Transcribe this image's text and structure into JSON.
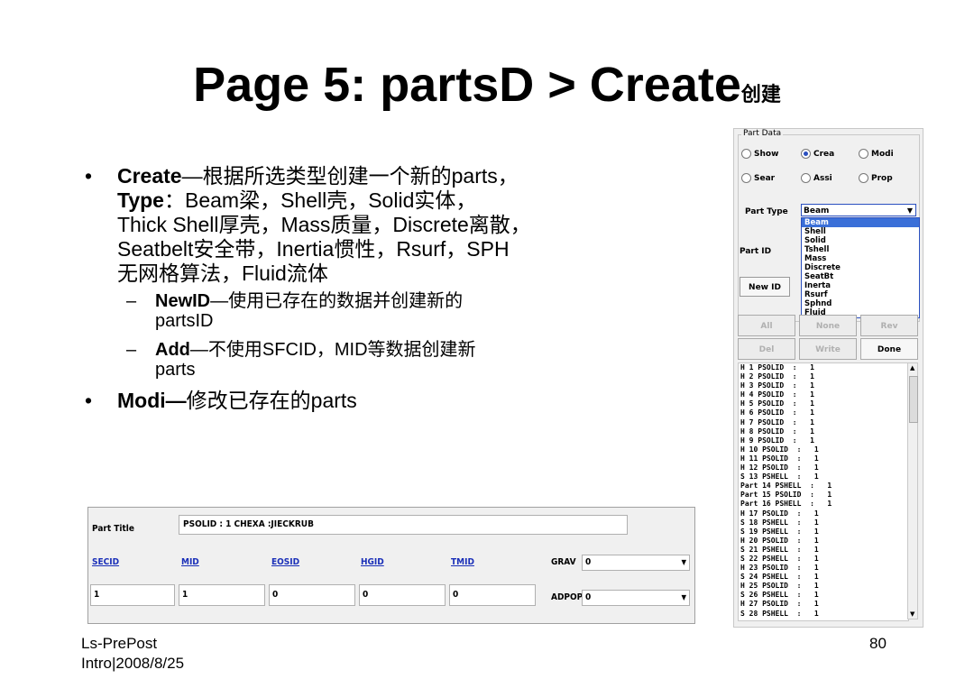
{
  "title": {
    "main": "Page 5: partsD > Create",
    "suffix": "创建"
  },
  "bullets": {
    "b1": {
      "lead": "Create",
      "rest": "—根据所选类型创建一个新的parts，",
      "line2_lead": "Type",
      "line2_rest": "：Beam梁，Shell壳，Solid实体，",
      "line3": "Thick Shell厚壳，Mass质量，Discrete离散，",
      "line4": "Seatbelt安全带，Inertia惯性，Rsurf，SPH",
      "line5": "无网格算法，Fluid流体"
    },
    "s1": {
      "dash": "–",
      "lead": "NewID",
      "rest": "—使用已存在的数据并创建新的",
      "line2": "partsID"
    },
    "s2": {
      "dash": "–",
      "lead": "Add",
      "rest": "—不使用SFCID，MID等数据创建新",
      "line2": "parts"
    },
    "b2": {
      "lead": "Modi—",
      "rest": "修改已存在的parts"
    },
    "dot": "•"
  },
  "footer": {
    "left1": "Ls-PrePost",
    "left2": "Intro|2008/8/25",
    "page": "80"
  },
  "part_data": {
    "legend": "Part Data",
    "radios": [
      {
        "label": "Show",
        "on": false
      },
      {
        "label": "Crea",
        "on": true
      },
      {
        "label": "Modi",
        "on": false
      },
      {
        "label": "Sear",
        "on": false
      },
      {
        "label": "Assi",
        "on": false
      },
      {
        "label": "Prop",
        "on": false
      }
    ],
    "part_type_label": "Part Type",
    "part_type_value": "Beam",
    "type_options": [
      "Beam",
      "Shell",
      "Solid",
      "Tshell",
      "Mass",
      "Discrete",
      "SeatBt",
      "Inerta",
      "Rsurf",
      "Sphnd",
      "Fluid"
    ],
    "part_id_label": "Part ID",
    "new_id_label": "New ID",
    "btn_all": "All",
    "btn_none": "None",
    "btn_rev": "Rev",
    "btn_del": "Del",
    "btn_write": "Write",
    "btn_done": "Done",
    "parts": [
      "H 1 PSOLID  :   1",
      "H 2 PSOLID  :   1",
      "H 3 PSOLID  :   1",
      "H 4 PSOLID  :   1",
      "H 5 PSOLID  :   1",
      "H 6 PSOLID  :   1",
      "H 7 PSOLID  :   1",
      "H 8 PSOLID  :   1",
      "H 9 PSOLID  :   1",
      "H 10 PSOLID  :   1",
      "H 11 PSOLID  :   1",
      "H 12 PSOLID  :   1",
      "S 13 PSHELL  :   1",
      "Part 14 PSHELL  :   1",
      "Part 15 PSOLID  :   1",
      "Part 16 PSHELL  :   1",
      "H 17 PSOLID  :   1",
      "S 18 PSHELL  :   1",
      "S 19 PSHELL  :   1",
      "H 20 PSOLID  :   1",
      "S 21 PSHELL  :   1",
      "S 22 PSHELL  :   1",
      "H 23 PSOLID  :   1",
      "S 24 PSHELL  :   1",
      "H 25 PSOLID  :   1",
      "S 26 PSHELL  :   1",
      "H 27 PSOLID  :   1",
      "S 28 PSHELL  :   1"
    ]
  },
  "part_title": {
    "label": "Part Title",
    "value": "PSOLID  :   1     CHEXA :JIECKRUB",
    "headers": [
      "SECID",
      "MID",
      "EOSID",
      "HGID",
      "TMID"
    ],
    "values": [
      "1",
      "1",
      "0",
      "0",
      "0"
    ],
    "grav_label": "GRAV",
    "grav_value": "0",
    "adpopt_label": "ADPOPT",
    "adpopt_value": "0"
  }
}
